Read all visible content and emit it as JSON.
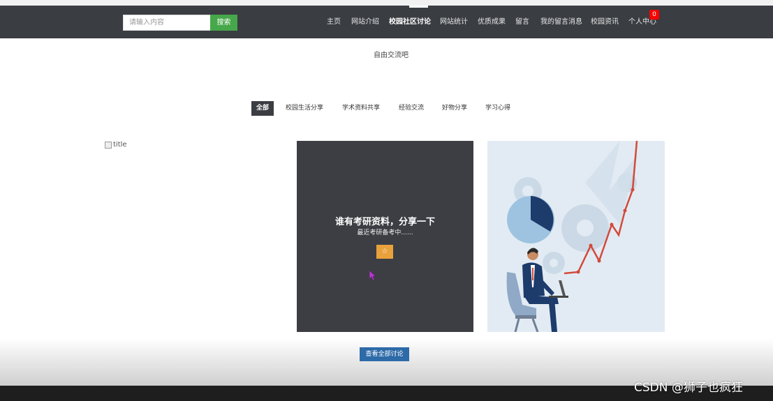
{
  "search": {
    "placeholder": "请输入内容",
    "button_label": "搜索"
  },
  "nav": {
    "items": [
      {
        "label": "主页"
      },
      {
        "label": "网站介绍"
      },
      {
        "label": "校园社区讨论"
      },
      {
        "label": "网站统计"
      },
      {
        "label": "优质成果"
      },
      {
        "label": "留言"
      },
      {
        "label": "我的留言消息"
      },
      {
        "label": "校园资讯"
      },
      {
        "label": "个人中心"
      }
    ],
    "active_index": 2,
    "badge_count": "0"
  },
  "page": {
    "subtitle": "自由交流吧"
  },
  "tabs": [
    {
      "label": "全部"
    },
    {
      "label": "校园生活分享"
    },
    {
      "label": "学术资料共享"
    },
    {
      "label": "经验交流"
    },
    {
      "label": "好物分享"
    },
    {
      "label": "学习心得"
    }
  ],
  "post_image_alt": "title",
  "featured_post": {
    "title": "谁有考研资料，分享一下",
    "excerpt": "最近考研备考中......",
    "star_glyph": "☆"
  },
  "view_all_label": "查看全部讨论",
  "watermark": "CSDN @狮子也疯狂",
  "colors": {
    "nav_bg": "#3a3d42",
    "search_button": "#46a84b",
    "badge": "#ff0000",
    "star_button": "#e9a13c",
    "view_all": "#2d6aa8"
  }
}
